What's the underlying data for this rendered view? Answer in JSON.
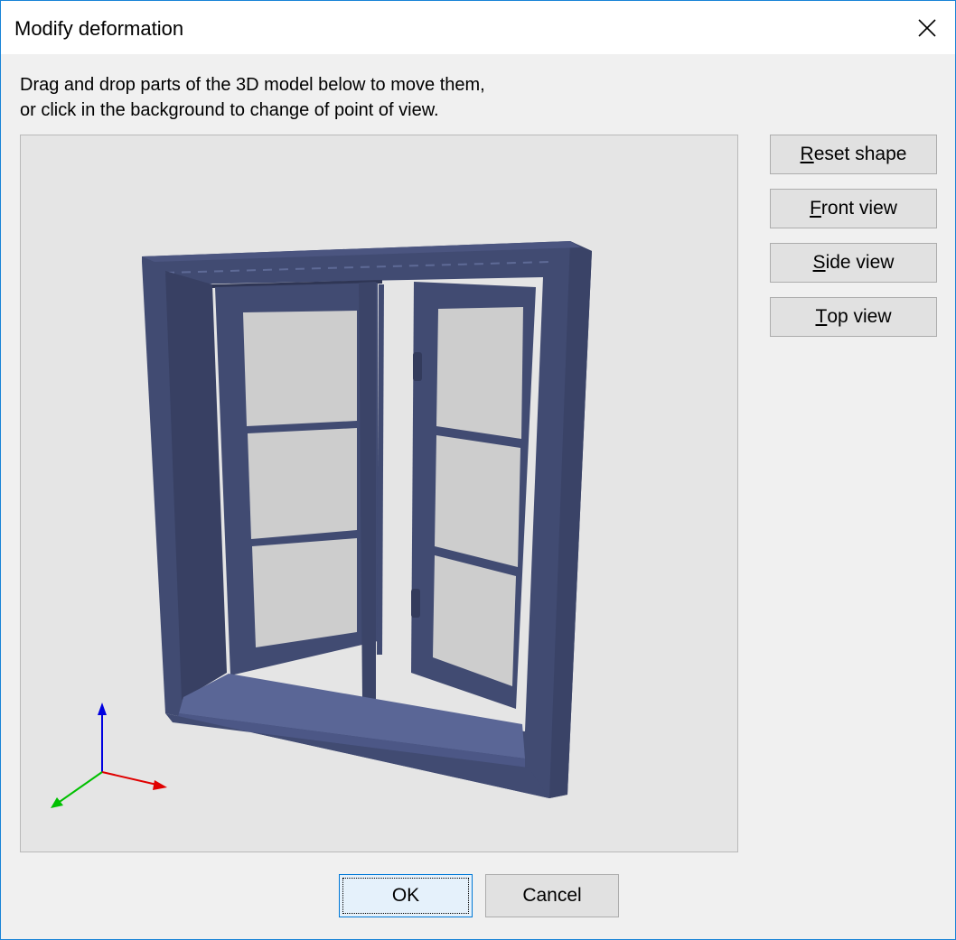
{
  "window": {
    "title": "Modify deformation",
    "close_icon": "close-icon"
  },
  "instructions": {
    "line1": "Drag and drop parts of the 3D model below to move them,",
    "line2": "or click in the background to change of point of view."
  },
  "side_buttons": [
    {
      "mnemonic": "R",
      "rest": "eset shape"
    },
    {
      "mnemonic": "F",
      "rest": "ront view"
    },
    {
      "mnemonic": "S",
      "rest": "ide view"
    },
    {
      "mnemonic": "T",
      "rest": "op view"
    }
  ],
  "footer": {
    "ok_label": "OK",
    "cancel_label": "Cancel"
  },
  "model": {
    "frame_color": "#414b72",
    "frame_dark": "#333b5c",
    "sill_color": "#5a6696",
    "glass_color": "#cdcdcd",
    "axis_x_color": "#e00000",
    "axis_y_color": "#00c000",
    "axis_z_color": "#0000e0"
  }
}
